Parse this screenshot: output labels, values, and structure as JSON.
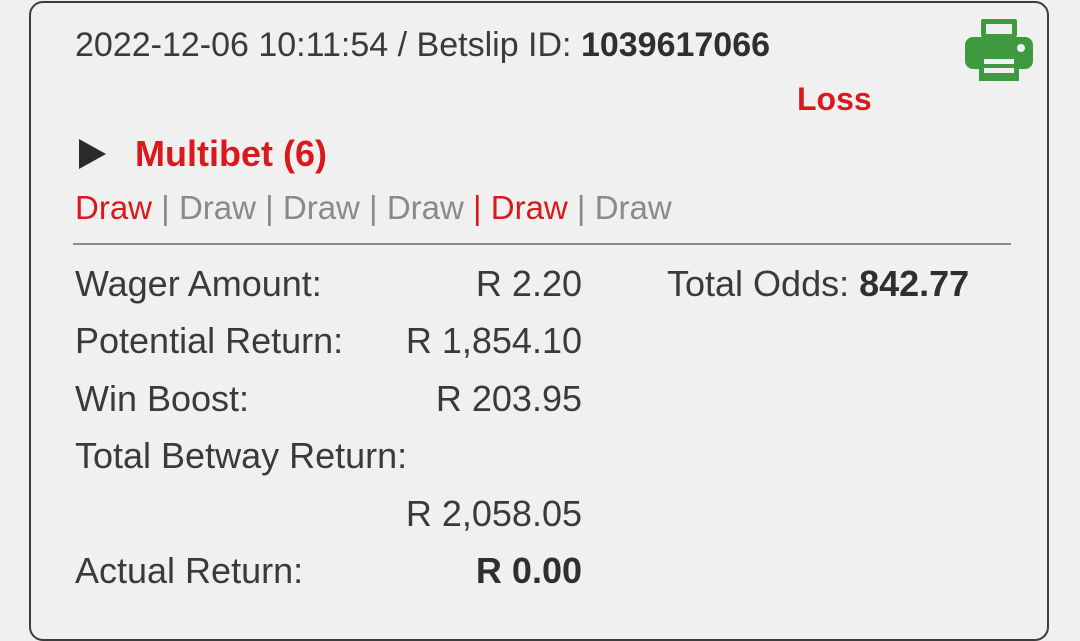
{
  "header": {
    "datetime": "2022-12-06 10:11:54",
    "separator": " / ",
    "betslip_label": "Betslip ID: ",
    "betslip_id": "1039617066"
  },
  "status": "Loss",
  "icons": {
    "print": "printer-icon",
    "expand": "play-triangle-icon"
  },
  "colors": {
    "loss": "#d9191c",
    "print": "#3f9a3f",
    "muted": "#8a8a8a"
  },
  "bet": {
    "title": "Multibet (6)",
    "outcomes": [
      {
        "label": "Draw",
        "highlight": true
      },
      {
        "label": "Draw",
        "highlight": false
      },
      {
        "label": "Draw",
        "highlight": false
      },
      {
        "label": "Draw",
        "highlight": false
      },
      {
        "label": "Draw",
        "highlight": true
      },
      {
        "label": "Draw",
        "highlight": false
      }
    ],
    "separator": " | "
  },
  "details": {
    "wager_label": "Wager Amount:",
    "wager_value": "R 2.20",
    "potential_label": "Potential Return:",
    "potential_value": "R 1,854.10",
    "boost_label": "Win Boost:",
    "boost_value": "R 203.95",
    "total_label": "Total Betway Return:",
    "total_value": "R 2,058.05",
    "actual_label": "Actual Return:",
    "actual_value": "R 0.00",
    "odds_label": "Total Odds: ",
    "odds_value": "842.77"
  }
}
